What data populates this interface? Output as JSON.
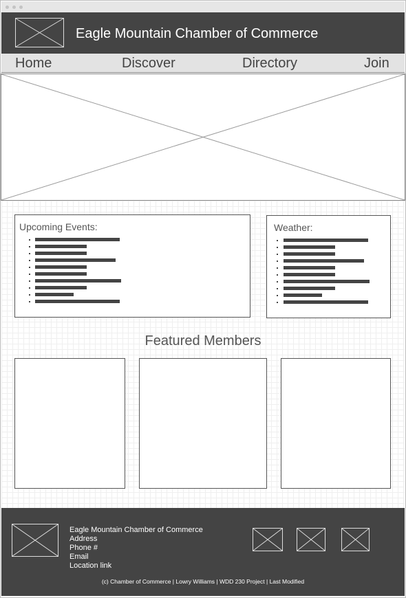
{
  "header": {
    "site_title": "Eagle Mountain Chamber of Commerce",
    "logo_icon": "image-placeholder-icon"
  },
  "nav": {
    "items": [
      {
        "label": "Home"
      },
      {
        "label": "Discover"
      },
      {
        "label": "Directory"
      },
      {
        "label": "Join"
      }
    ]
  },
  "hero": {
    "icon": "image-placeholder-icon"
  },
  "events": {
    "title": "Upcoming Events:",
    "item_count": 10
  },
  "weather": {
    "title": "Weather:",
    "item_count": 10
  },
  "featured": {
    "title": "Featured Members",
    "count": 3
  },
  "footer": {
    "org_name": "Eagle Mountain Chamber of Commerce",
    "address": "Address",
    "phone": "Phone #",
    "email": "Email",
    "location_link": "Location link",
    "social_icon": "image-placeholder-icon",
    "copyright": "(c) Chamber of Commerce  | Lowry Williams  | WDD 230 Project  | Last Modified"
  },
  "colors": {
    "header_bg": "#444444",
    "nav_bg": "#e3e3e3",
    "footer_bg": "#444444"
  }
}
